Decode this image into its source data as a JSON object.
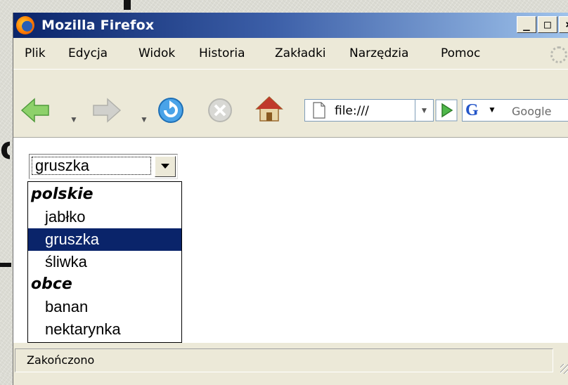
{
  "window": {
    "title": "Mozilla Firefox",
    "buttons": {
      "minimize": "_",
      "maximize": "□",
      "close": "×"
    }
  },
  "menubar": {
    "items": [
      "Plik",
      "Edycja",
      "Widok",
      "Historia",
      "Zakładki",
      "Narzędzia",
      "Pomoc"
    ]
  },
  "navbar": {
    "icons": [
      "back-arrow-icon",
      "forward-arrow-icon",
      "reload-icon",
      "stop-icon",
      "home-icon",
      "page-icon",
      "go-icon",
      "google-icon"
    ],
    "url": "file:///",
    "search_placeholder": "Google",
    "google_letter": "G"
  },
  "select": {
    "value": "gruszka",
    "options": [
      {
        "label": "polskie",
        "group": true
      },
      {
        "label": "jabłko"
      },
      {
        "label": "gruszka",
        "selected": true
      },
      {
        "label": "śliwka"
      },
      {
        "label": "obce",
        "group": true
      },
      {
        "label": "banan"
      },
      {
        "label": "nektarynka"
      }
    ]
  },
  "status": {
    "text": "Zakończono"
  },
  "colors": {
    "title_bar": "#0a246a",
    "selection": "#0a246a",
    "chrome": "#ece9d8"
  }
}
